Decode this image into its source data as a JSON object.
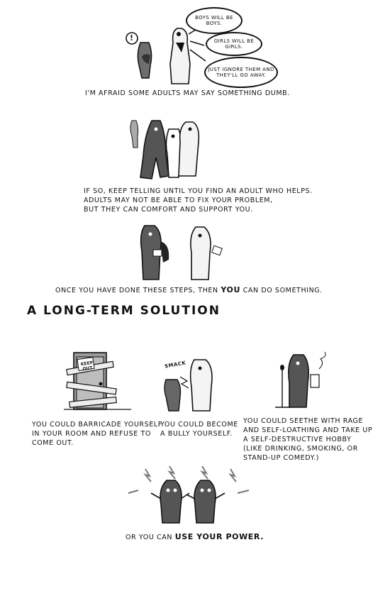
{
  "panel1": {
    "bubbles": [
      "BOYS WILL BE BOYS.",
      "GIRLS WILL BE GIRLS.",
      "JUST IGNORE THEM AND THEY'LL GO AWAY."
    ],
    "exclaim": "!",
    "caption": "I'M AFRAID SOME ADULTS MAY SAY SOMETHING DUMB."
  },
  "panel2": {
    "caption_lines": [
      "IF SO, KEEP TELLING UNTIL YOU FIND AN ADULT WHO HELPS.",
      "ADULTS MAY NOT BE ABLE TO FIX YOUR PROBLEM,",
      "BUT THEY CAN COMFORT AND SUPPORT YOU."
    ]
  },
  "panel3": {
    "caption_before": "ONCE YOU HAVE DONE THESE STEPS, THEN ",
    "caption_emph": "YOU",
    "caption_after": " CAN DO SOMETHING."
  },
  "section_heading": "A LONG-TERM SOLUTION",
  "options": {
    "door_sign": "KEEP OUT",
    "sound_effect": "SMACK",
    "barricade_lines": [
      "YOU COULD BARRICADE YOURSELF",
      "IN YOUR ROOM AND REFUSE TO",
      "COME OUT."
    ],
    "bully_lines": [
      "YOU COULD BECOME",
      "A BULLY YOURSELF."
    ],
    "seethe_lines": [
      "YOU COULD SEETHE WITH RAGE",
      "AND SELF-LOATHING AND TAKE UP",
      "A SELF-DESTRUCTIVE HOBBY",
      "(LIKE DRINKING, SMOKING, OR",
      "STAND-UP COMEDY.)"
    ]
  },
  "final": {
    "caption_before": "OR YOU CAN ",
    "caption_emph": "USE YOUR POWER."
  }
}
